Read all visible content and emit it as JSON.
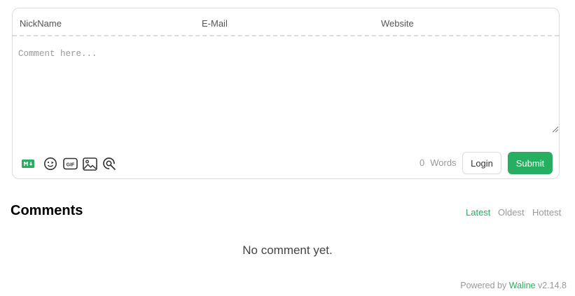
{
  "form": {
    "nick_placeholder": "NickName",
    "email_placeholder": "E-Mail",
    "website_placeholder": "Website",
    "comment_placeholder": "Comment here...",
    "word_count": "0",
    "words_label": "Words",
    "login_label": "Login",
    "submit_label": "Submit",
    "toolbar_icons": [
      "markdown-icon",
      "emoji-icon",
      "gif-icon",
      "image-icon",
      "preview-icon"
    ]
  },
  "comments": {
    "title": "Comments",
    "sort_options": [
      "Latest",
      "Oldest",
      "Hottest"
    ],
    "active_sort": "Latest",
    "empty_text": "No comment yet."
  },
  "footer": {
    "powered_by": "Powered by",
    "brand": "Waline",
    "version": "v2.14.8"
  },
  "colors": {
    "accent": "#27ae60",
    "border": "#dcdcdc",
    "muted_text": "#999999"
  }
}
